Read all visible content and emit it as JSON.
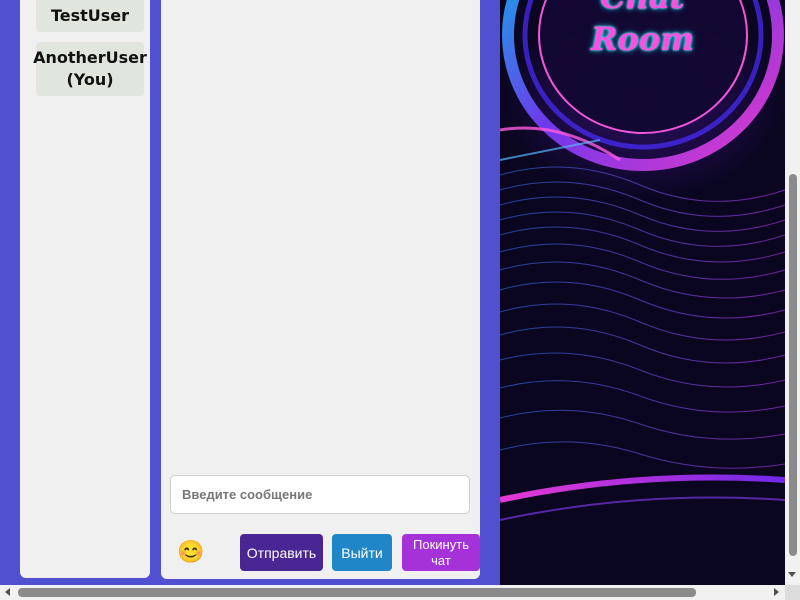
{
  "users": [
    {
      "name": "TestUser"
    },
    {
      "name": "AnotherUser (You)"
    }
  ],
  "composer": {
    "placeholder": "Введите сообщение",
    "emoji_glyph": "😊",
    "send_label": "Отправить",
    "exit_label": "Выйти",
    "leave_label": "Покинуть чат"
  },
  "hero": {
    "title_line1": "Chat",
    "title_line2": "Room"
  },
  "colors": {
    "page_background": "#5050d0",
    "send_button": "#4a2594",
    "exit_button": "#1f86c7",
    "leave_button": "#a532d8"
  }
}
